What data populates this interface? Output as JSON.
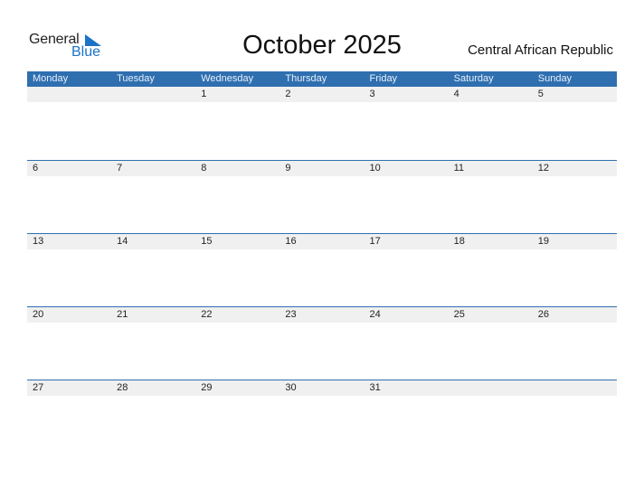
{
  "logo": {
    "word1": "General",
    "word2": "Blue",
    "accent_color": "#1a73c8"
  },
  "title": "October 2025",
  "country": "Central African Republic",
  "header_color": "#2f6fb0",
  "weekdays": [
    "Monday",
    "Tuesday",
    "Wednesday",
    "Thursday",
    "Friday",
    "Saturday",
    "Sunday"
  ],
  "weeks": [
    [
      "",
      "",
      "1",
      "2",
      "3",
      "4",
      "5"
    ],
    [
      "6",
      "7",
      "8",
      "9",
      "10",
      "11",
      "12"
    ],
    [
      "13",
      "14",
      "15",
      "16",
      "17",
      "18",
      "19"
    ],
    [
      "20",
      "21",
      "22",
      "23",
      "24",
      "25",
      "26"
    ],
    [
      "27",
      "28",
      "29",
      "30",
      "31",
      "",
      ""
    ]
  ]
}
